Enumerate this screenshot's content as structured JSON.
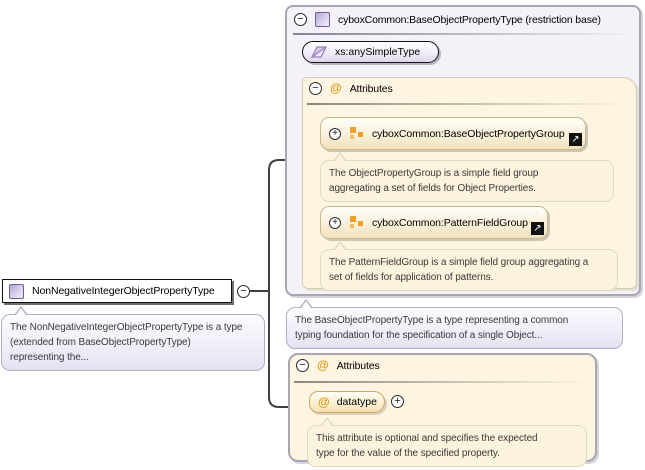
{
  "icons": {
    "collapse_glyph": "−",
    "expand_glyph": "+",
    "at_glyph": "@",
    "link_arrow_glyph": "↗"
  },
  "left_node": {
    "label": "NonNegativeIntegerObjectPropertyType",
    "description": "The NonNegativeIntegerObjectPropertyType is a type\n(extended from BaseObjectPropertyType)\nrepresenting the..."
  },
  "base_panel": {
    "title": "cyboxCommon:BaseObjectPropertyType (restriction base)",
    "base_type_label": "xs:anySimpleType",
    "attributes": {
      "title": "Attributes",
      "groups": [
        {
          "label": "cyboxCommon:BaseObjectPropertyGroup",
          "description": "The ObjectPropertyGroup is a simple field group\naggregating a set of fields for Object Properties."
        },
        {
          "label": "cyboxCommon:PatternFieldGroup",
          "description": "The PatternFieldGroup is a simple field group aggregating a\nset of fields for application of patterns."
        }
      ]
    },
    "description": "The BaseObjectPropertyType is a type representing a common\ntyping foundation for the specification of a single Object..."
  },
  "attributes_panel": {
    "title": "Attributes",
    "attribute": {
      "name": "datatype",
      "description": "This attribute is optional and specifies the expected\ntype for the value of the specified property."
    }
  },
  "colors": {
    "panel_lavender": "#f4f1f8",
    "panel_cream": "#fdf5e1",
    "accent_orange": "#e59a12",
    "accent_purple": "#9b7fc0",
    "connector": "#3f3f3f"
  }
}
